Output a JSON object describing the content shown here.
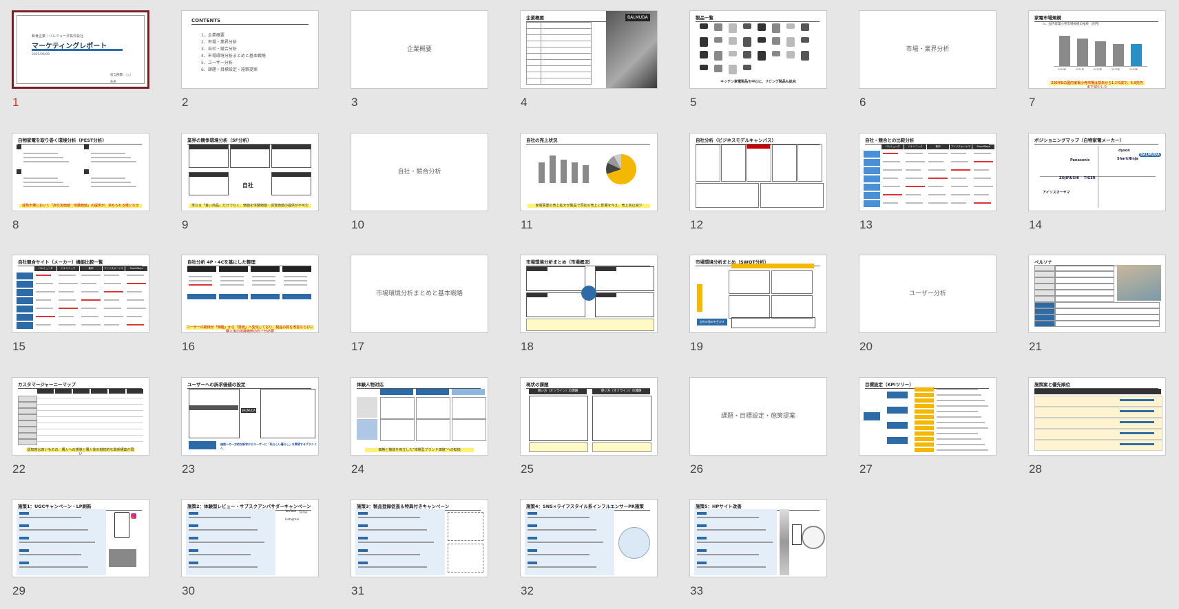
{
  "slides": [
    {
      "n": "1",
      "selected": true,
      "company": "和食企業｜バルミューダ株式会社",
      "title": "マーケティングレポート",
      "date": "2025/06/09",
      "author": "担当部署：○○",
      "author2": "氏名"
    },
    {
      "n": "2",
      "heading": "CONTENTS",
      "items": [
        "1、企業概要",
        "2、市場・業界分析",
        "3、自社・競合分析",
        "4、市場環境分析まとめと基本戦略",
        "5、ユーザー分析",
        "6、課題・目標設定・施策提案"
      ]
    },
    {
      "n": "3",
      "label": "企業概要"
    },
    {
      "n": "4",
      "title": "企業概要",
      "brand": "BALMUDA"
    },
    {
      "n": "5",
      "title": "製品一覧",
      "caption": "キッチン家電製品を中心に、リビング製品も拡充"
    },
    {
      "n": "6",
      "label": "市場・業界分析"
    },
    {
      "n": "7",
      "title": "家電市場規模",
      "chart_title": "①、国内家電小売市場規模の推移（兆円）",
      "bar_labels": [
        "2020年",
        "2021年",
        "2022年",
        "2023年",
        "2024年"
      ],
      "caption": "2024年の国内家電小売市場は前年から1.1%減で、6.9兆円まで減少した"
    },
    {
      "n": "8",
      "title": "白物家電を取り巻く環境分析（PEST分析）",
      "caption": "成熟市場において「高付加価値・体験価値」の提供が、求められる様になる"
    },
    {
      "n": "9",
      "title": "業界の競争環境分析（5F分析）",
      "center": "自社",
      "caption": "単なる「良い商品」だけでなく、価値を体験価値・感覚価値の提供が不可欠"
    },
    {
      "n": "10",
      "label": "自社・競合分析"
    },
    {
      "n": "11",
      "title": "自社の売上状況",
      "caption": "家電事業の売上拡大が製品で同社の売上に影響を与え、売上高は減少"
    },
    {
      "n": "12",
      "title": "自社分析（ビジネスモデルキャンバス）"
    },
    {
      "n": "13",
      "title": "自社・競合との比較分析",
      "cols": [
        "バルミューダ",
        "パナソニック",
        "象印",
        "アイリスオーヤマ",
        "SharkNinja"
      ]
    },
    {
      "n": "14",
      "title": "ポジショニングマップ（白物家電メーカー）",
      "brands": [
        "dyson",
        "BALMUDA",
        "Panasonic",
        "SharkNinja",
        "ZOJIRUSHI",
        "TIGER",
        "アイリスオーヤマ"
      ]
    },
    {
      "n": "15",
      "title": "自社競合サイト（メーカー）機能比較一覧",
      "cols": [
        "バルミューダ",
        "パナソニック",
        "象印",
        "アイリスオーヤマ",
        "SharkNinja"
      ]
    },
    {
      "n": "16",
      "title": "自社分析 4P・4Cを基にした整理",
      "caption": "ユーザーの期待が「価格」から「感覚」へ変化しており、製品の質を改善ならびに購入後の体験価値の向上が必要"
    },
    {
      "n": "17",
      "label": "市場環境分析まとめと基本戦略"
    },
    {
      "n": "18",
      "title": "市場環境分析まとめ（市場概況）"
    },
    {
      "n": "19",
      "title": "市場環境分析まとめ（SWOT分析）",
      "tag": "自社の強みを生かす"
    },
    {
      "n": "20",
      "label": "ユーザー分析"
    },
    {
      "n": "21",
      "title": "ペルソナ"
    },
    {
      "n": "22",
      "title": "カスタマージャーニーマップ",
      "caption": "認知度は高いものの、購入への誘導と購入後の継続的な関係構築が弱い"
    },
    {
      "n": "23",
      "title": "ユーザーへの訴求価値の設定",
      "tag": "BALMUDA",
      "caption": "価格への一方的な訴求からユーザーに「私らしい暮らし」を実現するブランドへ"
    },
    {
      "n": "24",
      "title": "体験人物対応",
      "caption": "価格と機能を両立した\"体験型ブランド価値\"への転換"
    },
    {
      "n": "25",
      "title": "現状の課題",
      "left": "買い方（オンライン）の課題",
      "right": "使い方（オフライン）の課題"
    },
    {
      "n": "26",
      "label": "課題・目標設定・施策提案"
    },
    {
      "n": "27",
      "title": "目標設定（KPIツリー）"
    },
    {
      "n": "28",
      "title": "施策案と優先順位"
    },
    {
      "n": "29",
      "title": "施策1：UGCキャンペーン・LP刷新"
    },
    {
      "n": "30",
      "title": "施策2：体験型レビュー・サブスクアンバサダーキャンペーン",
      "brands": [
        "YouTube",
        "TikTok",
        "Instagram"
      ]
    },
    {
      "n": "31",
      "title": "施策3：製品登録促進＆特典付きキャンペーン"
    },
    {
      "n": "32",
      "title": "施策4：SNS×ライフスタイル系インフルエンサーPR施策"
    },
    {
      "n": "33",
      "title": "施策5：HPサイト改善"
    }
  ],
  "colors": {
    "selected_border": "#7b1e22",
    "selected_number": "#c43e1c",
    "accent_blue": "#2d6aa8",
    "highlight_yellow": "#fff176",
    "app_background": "#e6e6e6"
  }
}
